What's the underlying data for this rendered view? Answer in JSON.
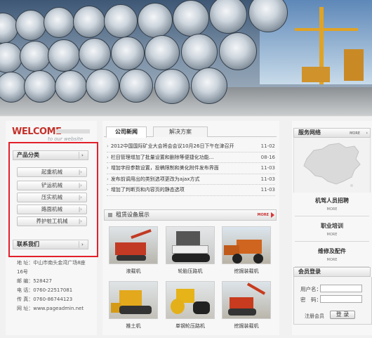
{
  "welcome": {
    "title": "WELCOME",
    "subtitle": "to our website"
  },
  "left": {
    "category_title": "产品分类",
    "categories": [
      "起重机械",
      "铲运机械",
      "压实机械",
      "路面机械",
      "养护桩工机械"
    ],
    "contact_title": "联系我们",
    "contact_lines": [
      "地 址：中山市南头金湾广场8座16号",
      "邮 编：528427",
      "电 话：0760-22517081",
      "传 真：0760-86744123",
      "网 址：www.pageadmin.net"
    ]
  },
  "tabs": [
    "公司新闻",
    "解决方案"
  ],
  "news": [
    {
      "title": "2012中国国际矿业大会将会会议10月26日下午在津召开",
      "date": "11-02"
    },
    {
      "title": "栏目管理增加了批量设置和删除等便捷化功能...",
      "date": "08-16"
    },
    {
      "title": "增加字段参数设置，投稿限制和美化附件发布界面",
      "date": "11-03"
    },
    {
      "title": "发布前调用出的类别选项更改为ajax方式",
      "date": "11-03"
    },
    {
      "title": "增加了判断页和内容页的静态选项",
      "date": "11-03"
    }
  ],
  "equipment": {
    "title": "租赁设备展示",
    "more": "MORE",
    "items": [
      "液载机",
      "轮胎压路机",
      "挖掘装载机",
      "推土机",
      "单钢轮压路机",
      "挖掘装载机"
    ]
  },
  "right": {
    "service_title": "服务网络",
    "more": "MORE",
    "links": [
      {
        "title": "机驾人员招聘",
        "more": "MORE"
      },
      {
        "title": "职业培训",
        "more": "MORE"
      },
      {
        "title": "维修及配件",
        "more": "MORE"
      }
    ],
    "login_title": "会员登录",
    "username_label": "用户名：",
    "password_label": "密　码：",
    "register": "注册会员",
    "login_button": "登 录"
  },
  "colors": {
    "accent_red": "#c4322b",
    "highlight_box": "#e2202b"
  }
}
